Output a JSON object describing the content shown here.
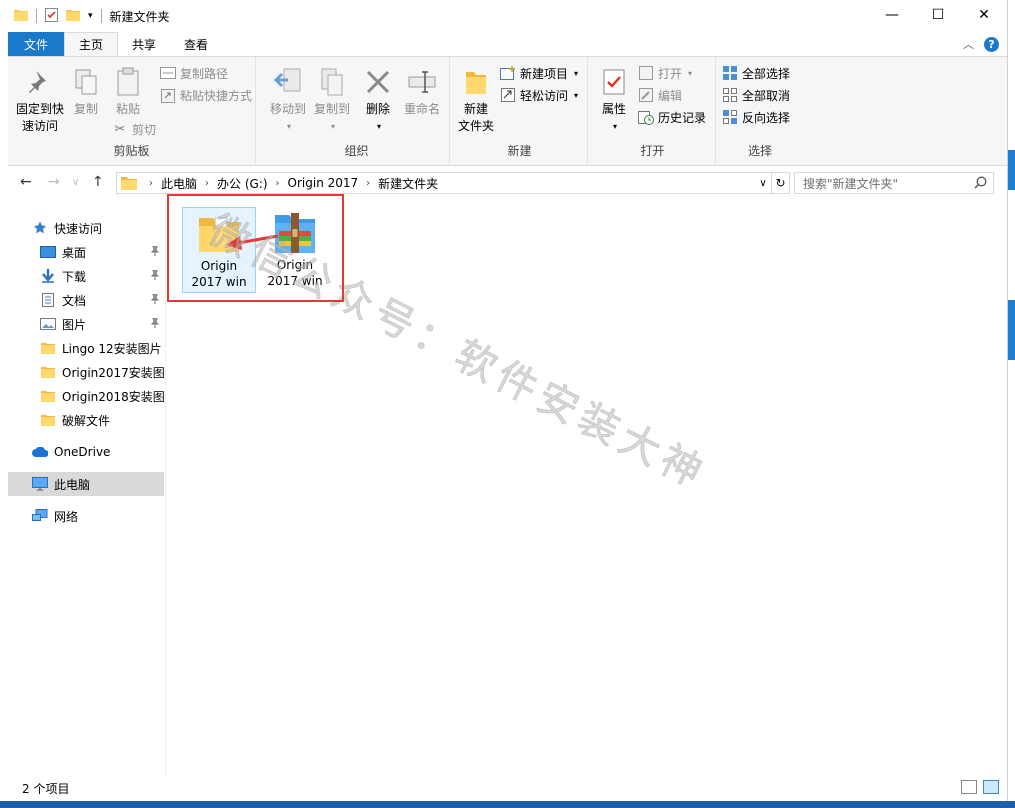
{
  "window": {
    "title": "新建文件夹",
    "controls": {
      "minimize": "—",
      "maximize": "☐",
      "close": "✕"
    }
  },
  "ribbon_tabs": [
    {
      "label": "文件"
    },
    {
      "label": "主页"
    },
    {
      "label": "共享"
    },
    {
      "label": "查看"
    }
  ],
  "ribbon": {
    "clipboard": {
      "label": "剪贴板",
      "pin_quick_access": [
        "固定到快",
        "速访问"
      ],
      "copy": "复制",
      "paste": "粘贴",
      "copy_path": "复制路径",
      "paste_shortcut": "粘贴快捷方式",
      "cut": "剪切"
    },
    "organize": {
      "label": "组织",
      "move_to": "移动到",
      "copy_to": "复制到",
      "delete": "删除",
      "rename": "重命名"
    },
    "new": {
      "label": "新建",
      "new_folder": [
        "新建",
        "文件夹"
      ],
      "new_item": "新建项目",
      "easy_access": "轻松访问"
    },
    "open": {
      "label": "打开",
      "properties": "属性",
      "open": "打开",
      "edit": "编辑",
      "history": "历史记录"
    },
    "select": {
      "label": "选择",
      "select_all": "全部选择",
      "select_none": "全部取消",
      "invert": "反向选择"
    }
  },
  "address": {
    "crumbs": [
      "此电脑",
      "办公 (G:)",
      "Origin 2017",
      "新建文件夹"
    ],
    "search_placeholder": "搜索\"新建文件夹\""
  },
  "sidebar": {
    "quick_access": "快速访问",
    "items": [
      {
        "label": "桌面",
        "icon": "desktop-icon",
        "pinned": true
      },
      {
        "label": "下载",
        "icon": "download-icon",
        "pinned": true
      },
      {
        "label": "文档",
        "icon": "document-icon",
        "pinned": true
      },
      {
        "label": "图片",
        "icon": "picture-icon",
        "pinned": true
      },
      {
        "label": "Lingo 12安装图片",
        "icon": "folder-icon",
        "pinned": false
      },
      {
        "label": "Origin2017安装图片",
        "icon": "folder-icon",
        "pinned": false
      },
      {
        "label": "Origin2018安装图片",
        "icon": "folder-icon",
        "pinned": false
      },
      {
        "label": "破解文件",
        "icon": "folder-icon",
        "pinned": false
      }
    ],
    "onedrive": "OneDrive",
    "this_pc": "此电脑",
    "network": "网络"
  },
  "files": [
    {
      "name_line1": "Origin",
      "name_line2": "2017 win",
      "icon": "folder-icon",
      "selected": true
    },
    {
      "name_line1": "Origin",
      "name_line2": "2017 win",
      "icon": "winrar-archive-icon",
      "selected": false
    }
  ],
  "watermark": "微信公众号：软件安装大神",
  "status": {
    "item_count": "2 个项目"
  },
  "colors": {
    "accent": "#1979ca",
    "highlight_box": "#e53935",
    "folder": "#f6c85f"
  }
}
